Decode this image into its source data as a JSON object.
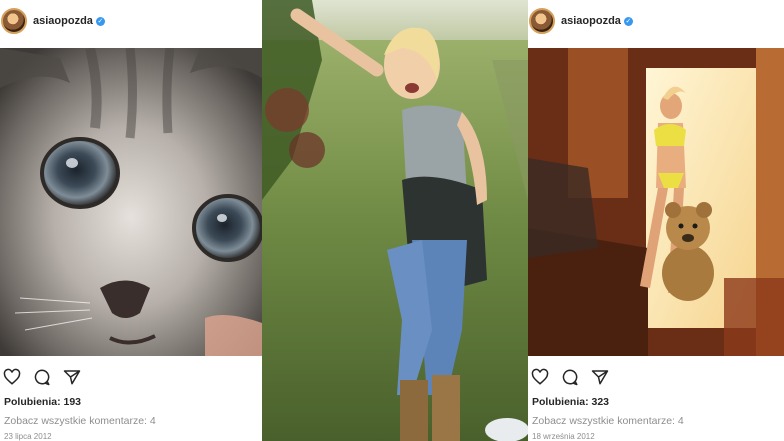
{
  "posts": {
    "left": {
      "username": "asiaopozda",
      "likes": "Polubienia: 193",
      "comments": "Zobacz wszystkie komentarze: 4",
      "date": "23 lipca 2012"
    },
    "right": {
      "username": "asiaopozda",
      "likes": "Polubienia: 323",
      "comments": "Zobacz wszystkie komentarze: 4",
      "date": "18 września 2012"
    }
  },
  "icons": [
    "heart-icon",
    "comment-icon",
    "share-icon",
    "verified-badge-icon"
  ],
  "colors": {
    "verified": "#3897f0",
    "text": "#262626",
    "muted": "#8e8e8e"
  }
}
